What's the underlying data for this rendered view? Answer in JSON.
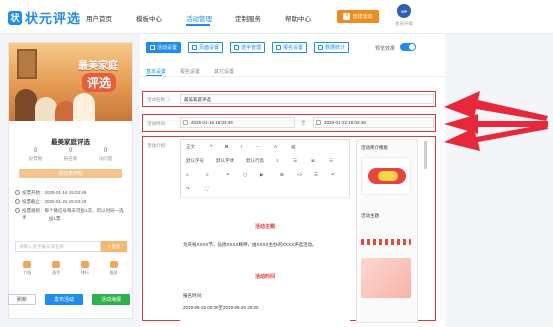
{
  "brand": {
    "logo_text": "状元评选",
    "logo_mark": "状"
  },
  "nav": {
    "items": [
      "用户首页",
      "模板中心",
      "活动管理",
      "定制服务",
      "帮助中心"
    ],
    "create_button": "创建活动",
    "vip_badge": "VIP",
    "vip_label": "会员升级"
  },
  "preview": {
    "banner_title": "最美家庭",
    "banner_sub": "评选",
    "title": "最美家庭评选",
    "stats": [
      {
        "value": "0",
        "label": "投票数"
      },
      {
        "value": "0",
        "label": "报名数"
      },
      {
        "value": "0",
        "label": "访问量"
      }
    ],
    "status_bar": "活动未开始",
    "info": [
      "投票开始：2025-01-16 15:03:49",
      "投票截止：2025-01-22 15:03:49",
      "投票规则：每个微信号每天可投1次，可以对同一选手",
      "投1票"
    ],
    "search_placeholder": "请输入选手编号或名称",
    "search_button": "搜索",
    "tabs": [
      "介绍",
      "选手",
      "排行",
      "报名"
    ],
    "actions": {
      "refresh": "刷新",
      "publish": "发布活动",
      "poster": "活动海报"
    }
  },
  "toolbar": {
    "buttons": [
      "活动设置",
      "页面设置",
      "选手管理",
      "报名设置",
      "数据统计"
    ],
    "preview_switch_label": "预览效果"
  },
  "subtabs": [
    "基本设置",
    "报名设置",
    "其它设置"
  ],
  "form": {
    "name_label": "活动名称",
    "name_value": "最美家庭评选",
    "time_label": "活动时间",
    "time_start": "2025-01-16 15:03:49",
    "time_sep": "至",
    "time_end": "2025-01-22 15:03:49",
    "intro_label": "活动介绍"
  },
  "editor": {
    "row1": [
      "正文",
      "❝",
      "B",
      "I",
      "⋯",
      "A",
      "▤",
      "≡",
      "⊞"
    ],
    "row2": [
      "默认字号",
      "默认字体",
      "默认行高",
      "≡",
      "☰",
      "≣",
      "☷"
    ],
    "row3": [
      "☺",
      "⚭",
      "▢",
      "▶",
      "⊞",
      "<>",
      "☰",
      "↶"
    ],
    "row4": [
      "↷",
      "⛶"
    ],
    "heading1": "活动主题",
    "text1": "为庆祝XXXX节，弘扬XXXX精神，由XXXX主办的XXXX评选活动。",
    "heading2": "活动时间",
    "text2": "报名时间：",
    "text3": "2019-06-10 00:00至2019-06-20 20:00"
  },
  "template_panel": {
    "title": "活动简介模板",
    "theme_label": "活动主题"
  },
  "colors": {
    "accent": "#1e8cf0",
    "highlight": "#e23a3a",
    "orange": "#f08c1e",
    "green": "#2bb24c"
  }
}
